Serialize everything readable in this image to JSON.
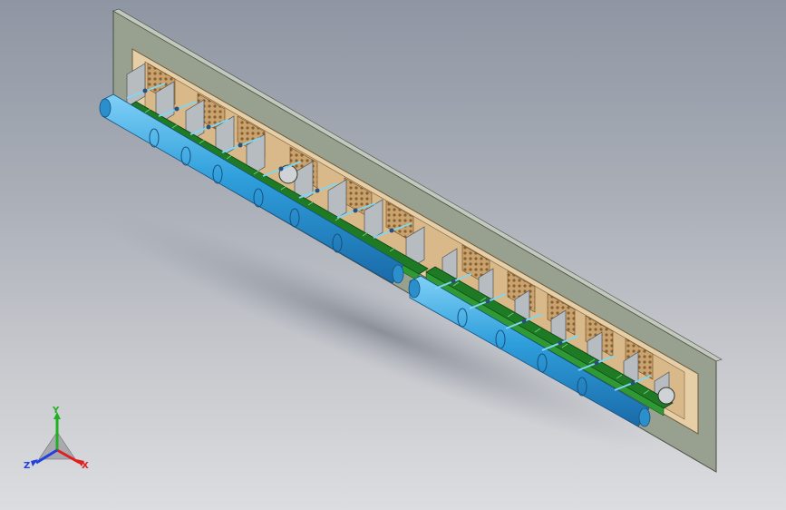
{
  "viewport": {
    "background_top": "#8f96a3",
    "background_bottom": "#dcdde0"
  },
  "model": {
    "wall_color": "#98a08f",
    "frame_color": "#e6cfa6",
    "pipe_color": "#3aa3dc",
    "conveyor_color": "#1e7a24",
    "panel_color": "#b7bcc0"
  },
  "triad": {
    "x_label": "X",
    "y_label": "Y",
    "z_label": "Z",
    "x_color": "#e02020",
    "y_color": "#20b020",
    "z_color": "#2040e0"
  }
}
